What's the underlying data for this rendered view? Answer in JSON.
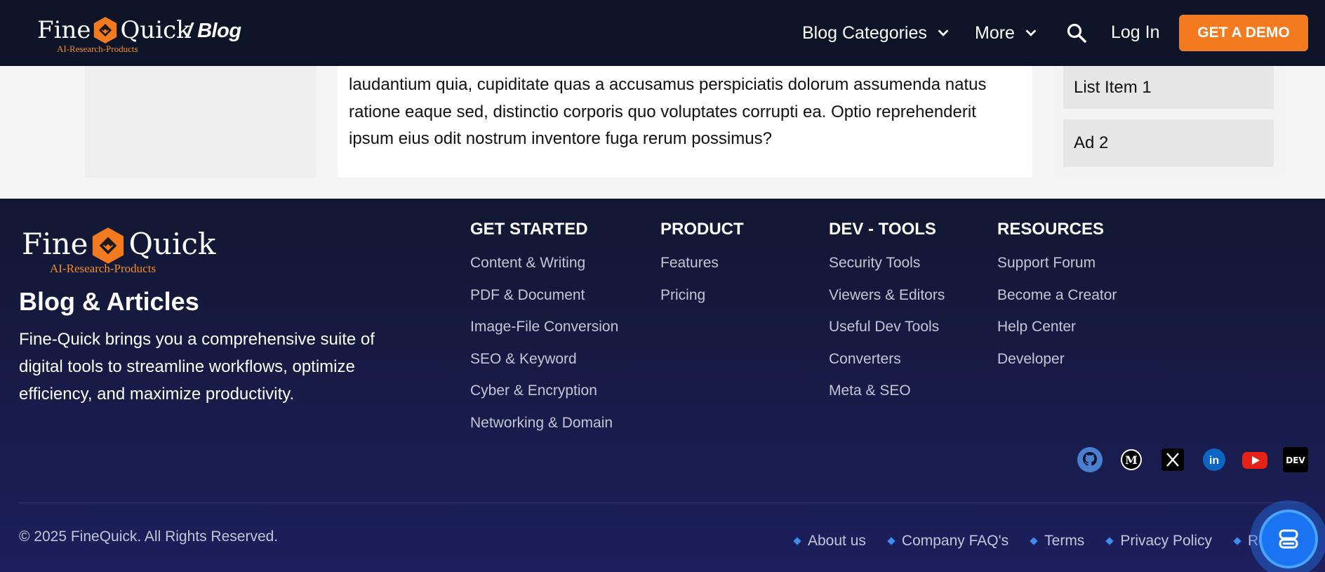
{
  "header": {
    "logo": {
      "word1": "Fine",
      "word2": "Quick",
      "tagline": "AI-Research-Products"
    },
    "section": "/ Blog",
    "nav": [
      {
        "label": "Blog Categories"
      },
      {
        "label": "More"
      }
    ],
    "login_label": "Log In",
    "demo_label": "GET A DEMO"
  },
  "article": {
    "text": "laudantium quia, cupiditate quas a accusamus perspiciatis dolorum assumenda natus ratione eaque sed, distinctio corporis quo voluptates corrupti ea. Optio reprehenderit ipsum eius odit nostrum inventore fuga rerum possimus?"
  },
  "sidebar": {
    "items": [
      "List Item 1",
      "Ad 2"
    ]
  },
  "footer": {
    "logo": {
      "word1": "Fine",
      "word2": "Quick",
      "tagline": "AI-Research-Products"
    },
    "title": "Blog & Articles",
    "description": "Fine-Quick brings you a comprehensive suite of digital tools to streamline workflows, optimize efficiency, and maximize productivity.",
    "columns": [
      {
        "heading": "GET STARTED",
        "links": [
          "Content & Writing",
          "PDF & Document",
          "Image-File Conversion",
          "SEO & Keyword",
          "Cyber & Encryption",
          "Networking & Domain"
        ]
      },
      {
        "heading": "PRODUCT",
        "links": [
          "Features",
          "Pricing"
        ]
      },
      {
        "heading": "DEV - TOOLS",
        "links": [
          "Security Tools",
          "Viewers & Editors",
          "Useful Dev Tools",
          "Converters",
          "Meta & SEO"
        ]
      },
      {
        "heading": "RESOURCES",
        "links": [
          "Support Forum",
          "Become a Creator",
          "Help Center",
          "Developer"
        ]
      }
    ],
    "social": [
      {
        "icon": "github-icon",
        "color": "#4a7fd0"
      },
      {
        "icon": "medium-icon",
        "color": "#000000"
      },
      {
        "icon": "x-icon",
        "color": "#000000"
      },
      {
        "icon": "linkedin-icon",
        "color": "#0a66c2"
      },
      {
        "icon": "youtube-icon",
        "color": "#e62117"
      },
      {
        "icon": "dev-icon",
        "color": "#000000",
        "text": "DEV"
      }
    ],
    "copyright": "© 2025 FineQuick. All Rights Reserved.",
    "bottom_links": [
      "About us",
      "Company FAQ's",
      "Terms",
      "Privacy Policy",
      "Refund"
    ]
  },
  "colors": {
    "header_bg": "#0e1427",
    "accent": "#f47a20",
    "footer_bg_top": "#121731",
    "footer_bg_bottom": "#1c1f5c",
    "link_dot": "#3a8ef0"
  }
}
